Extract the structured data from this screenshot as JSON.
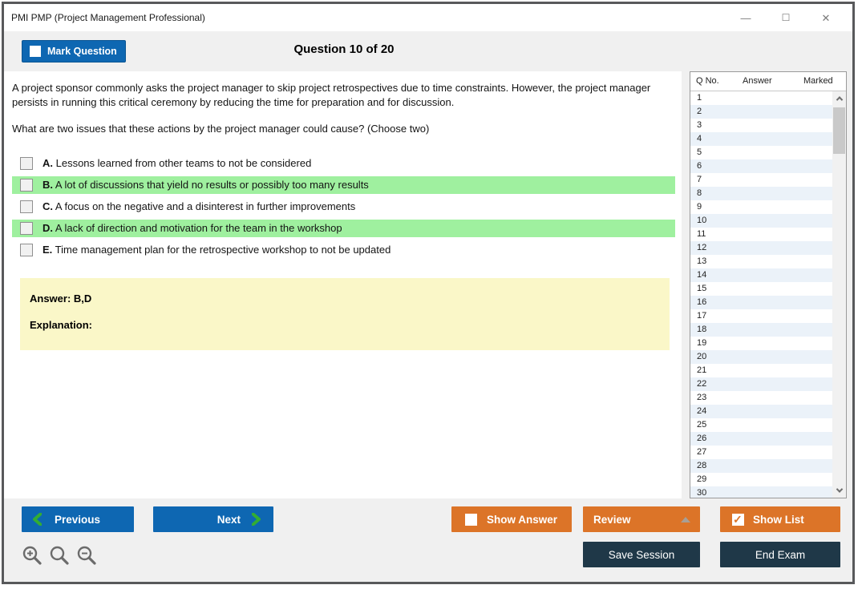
{
  "window": {
    "title": "PMI PMP (Project Management Professional)",
    "controls": {
      "minimize": "—",
      "maximize": "☐",
      "close": "✕"
    }
  },
  "header": {
    "mark_question_label": "Mark Question",
    "mark_question_checked": false,
    "question_counter": "Question 10 of 20"
  },
  "question": {
    "paragraph1": "A project sponsor commonly asks the project manager to skip project retrospectives due to time constraints. However, the project manager persists in running this critical ceremony by reducing the time for preparation and for discussion.",
    "paragraph2": "What are two issues that these actions by the project manager could cause? (Choose two)",
    "options": [
      {
        "letter": "A.",
        "text": "Lessons learned from other teams to not be considered",
        "highlighted": false,
        "checked": false
      },
      {
        "letter": "B.",
        "text": "A lot of discussions that yield no results or possibly too many results",
        "highlighted": true,
        "checked": false
      },
      {
        "letter": "C.",
        "text": "A focus on the negative and a disinterest in further improvements",
        "highlighted": false,
        "checked": false
      },
      {
        "letter": "D.",
        "text": "A lack of direction and motivation for the team in the workshop",
        "highlighted": true,
        "checked": false
      },
      {
        "letter": "E.",
        "text": "Time management plan for the retrospective workshop to not be updated",
        "highlighted": false,
        "checked": false
      }
    ],
    "answer_label": "Answer: B,D",
    "explanation_label": "Explanation:"
  },
  "sidebar": {
    "columns": [
      "Q No.",
      "Answer",
      "Marked"
    ],
    "rows": [
      "1",
      "2",
      "3",
      "4",
      "5",
      "6",
      "7",
      "8",
      "9",
      "10",
      "11",
      "12",
      "13",
      "14",
      "15",
      "16",
      "17",
      "18",
      "19",
      "20",
      "21",
      "22",
      "23",
      "24",
      "25",
      "26",
      "27",
      "28",
      "29",
      "30"
    ],
    "scrollbar": {
      "up_icon": "chevron-up",
      "down_icon": "chevron-down"
    }
  },
  "footer": {
    "previous_label": "Previous",
    "next_label": "Next",
    "show_answer_label": "Show Answer",
    "show_answer_checked": false,
    "review_label": "Review",
    "show_list_label": "Show List",
    "show_list_checked": true,
    "save_session_label": "Save Session",
    "end_exam_label": "End Exam",
    "zoom_icons": [
      "zoom-in",
      "zoom",
      "zoom-out"
    ]
  },
  "colors": {
    "accent_blue": "#0e67b2",
    "accent_orange": "#dc7428",
    "accent_navy": "#1f3848",
    "highlight_green": "#9ff09f",
    "answer_yellow": "#faf7c8",
    "alt_row_blue": "#ebf2f9",
    "chevron_green": "#33ad33"
  }
}
